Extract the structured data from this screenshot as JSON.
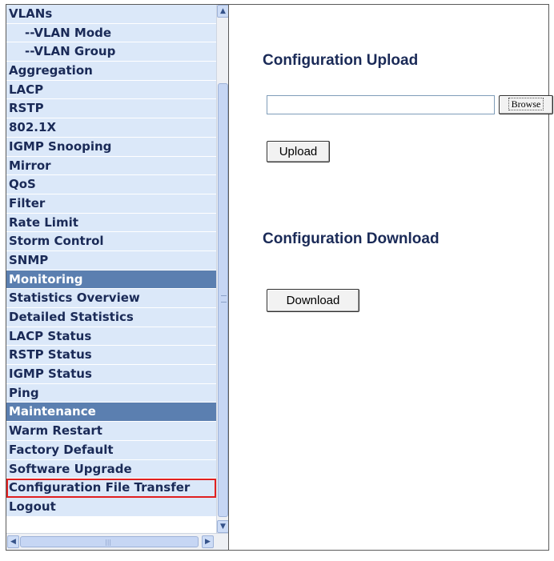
{
  "sidebar": {
    "items": [
      {
        "label": "VLANs",
        "type": "item"
      },
      {
        "label": "--VLAN Mode",
        "type": "sub"
      },
      {
        "label": "--VLAN Group",
        "type": "sub"
      },
      {
        "label": "Aggregation",
        "type": "item"
      },
      {
        "label": "LACP",
        "type": "item"
      },
      {
        "label": "RSTP",
        "type": "item"
      },
      {
        "label": "802.1X",
        "type": "item"
      },
      {
        "label": "IGMP Snooping",
        "type": "item"
      },
      {
        "label": "Mirror",
        "type": "item"
      },
      {
        "label": "QoS",
        "type": "item"
      },
      {
        "label": "Filter",
        "type": "item"
      },
      {
        "label": "Rate Limit",
        "type": "item"
      },
      {
        "label": "Storm Control",
        "type": "item"
      },
      {
        "label": "SNMP",
        "type": "item"
      },
      {
        "label": "Monitoring",
        "type": "header"
      },
      {
        "label": "Statistics Overview",
        "type": "item"
      },
      {
        "label": "Detailed Statistics",
        "type": "item"
      },
      {
        "label": "LACP Status",
        "type": "item"
      },
      {
        "label": "RSTP Status",
        "type": "item"
      },
      {
        "label": "IGMP Status",
        "type": "item"
      },
      {
        "label": "Ping",
        "type": "item"
      },
      {
        "label": "Maintenance",
        "type": "header"
      },
      {
        "label": "Warm Restart",
        "type": "item"
      },
      {
        "label": "Factory Default",
        "type": "item"
      },
      {
        "label": "Software Upgrade",
        "type": "item"
      },
      {
        "label": "Configuration File Transfer",
        "type": "item",
        "selected": true
      },
      {
        "label": "Logout",
        "type": "item"
      }
    ]
  },
  "scrollbar": {
    "up_icon": "arrow-up-icon",
    "down_icon": "arrow-down-icon",
    "left_icon": "arrow-left-icon",
    "right_icon": "arrow-right-icon"
  },
  "upload": {
    "title": "Configuration Upload",
    "file_value": "",
    "browse_label": "Browse",
    "button_label": "Upload"
  },
  "download": {
    "title": "Configuration Download",
    "button_label": "Download"
  },
  "colors": {
    "menu_bg": "#dbe8f9",
    "menu_text": "#1a2a57",
    "header_bg": "#5b7fb0",
    "selected_outline": "#e02020"
  }
}
